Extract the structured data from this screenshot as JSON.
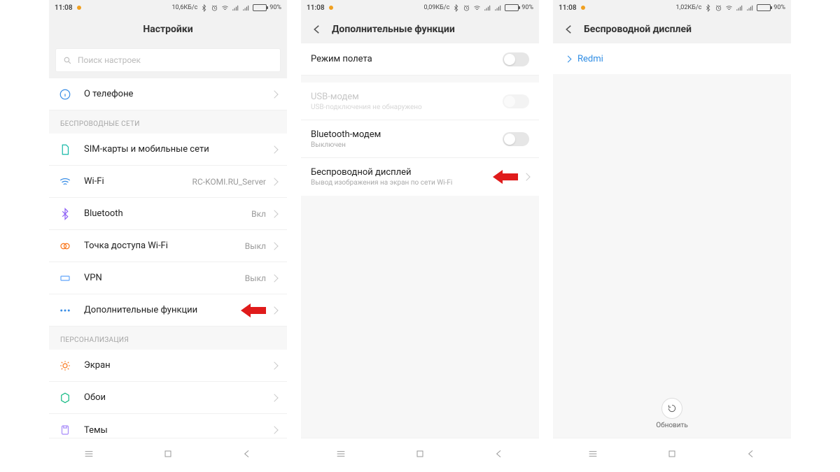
{
  "status": {
    "time": "11:08",
    "net1": "10,6КБ/с",
    "net2": "0,09КБ/с",
    "net3": "1,02КБ/с",
    "battery_pct": "90%"
  },
  "p1": {
    "title": "Настройки",
    "search_placeholder": "Поиск настроек",
    "about_label": "О телефоне",
    "section_wireless": "БЕСПРОВОДНЫЕ СЕТИ",
    "sim_label": "SIM-карты и мобильные сети",
    "wifi_label": "Wi-Fi",
    "wifi_value": "RC-KOMI.RU_Server",
    "bt_label": "Bluetooth",
    "bt_value": "Вкл",
    "hotspot_label": "Точка доступа Wi-Fi",
    "hotspot_value": "Выкл",
    "vpn_label": "VPN",
    "vpn_value": "Выкл",
    "more_label": "Дополнительные функции",
    "section_personal": "ПЕРСОНАЛИЗАЦИЯ",
    "display_label": "Экран",
    "wallpaper_label": "Обои",
    "themes_label": "Темы"
  },
  "p2": {
    "title": "Дополнительные функции",
    "airplane_label": "Режим полета",
    "usb_label": "USB-модем",
    "usb_sub": "USB-подключения не обнаружено",
    "bt_label": "Bluetooth-модем",
    "bt_sub": "Выключен",
    "cast_label": "Беспроводной дисплей",
    "cast_sub": "Вывод изображения на экран по сети Wi-Fi"
  },
  "p3": {
    "title": "Беспроводной дисплей",
    "device": "Redmi",
    "refresh": "Обновить"
  }
}
